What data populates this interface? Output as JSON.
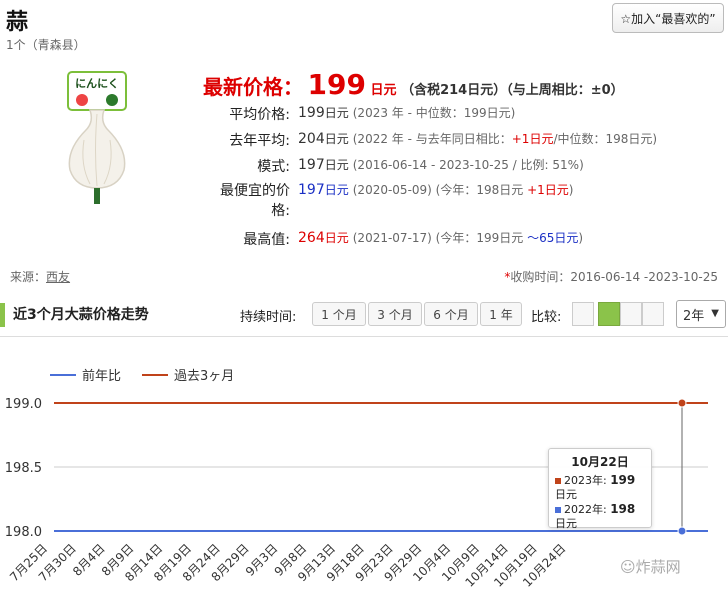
{
  "header": {
    "title": "蒜",
    "subtitle": "1个（青森县）",
    "fav_button": "☆加入“最喜欢的”"
  },
  "product_image": {
    "label_text": "にんにく"
  },
  "latest": {
    "label": "最新价格：",
    "value": "199",
    "unit": "日元",
    "note": "（含税214日元）（与上周相比：±0）"
  },
  "stats": [
    {
      "key": "平均价格:",
      "value": "199",
      "unit": "日元",
      "value_color": "normal",
      "note": "(2023 年 - 中位数：199日元)"
    },
    {
      "key": "去年平均:",
      "value": "204",
      "unit": "日元",
      "value_color": "normal",
      "note_pre": "(2022 年 - 与去年同日相比：",
      "note_hl": "+1日元",
      "note_post": "/中位数：198日元)"
    },
    {
      "key": "模式:",
      "value": "197",
      "unit": "日元",
      "value_color": "normal",
      "note": "(2016-06-14 - 2023-10-25 / 比例: 51%)"
    },
    {
      "key_line1": "最便宜的价",
      "key_line2": "格:",
      "value": "197",
      "unit": "日元",
      "value_color": "blue",
      "note_pre": "(2020-05-09) (今年：198日元 ",
      "note_hl": "+1日元",
      "note_post": ")"
    },
    {
      "key": "最高值:",
      "value": "264",
      "unit": "日元",
      "value_color": "red",
      "note_pre": "(2021-07-17) (今年：199日元 ",
      "note_hl": "～65日元",
      "note_post": ")"
    }
  ],
  "source": {
    "label": "来源：",
    "link": "西友"
  },
  "period": {
    "star": "*",
    "text": "收购时间：2016-06-14 -2023-10-25"
  },
  "trend": {
    "title": "近3个月大蒜价格走势",
    "duration_label": "持续时间:",
    "duration_buttons": [
      "1 个月",
      "3 个月",
      "6 个月",
      "1 年"
    ],
    "compare_label": "比较:",
    "year_select": "2年"
  },
  "colors": {
    "blue_series": "#4a6fd8",
    "red_series": "#c0431a",
    "accent_green": "#8bc34a"
  },
  "chart_data": {
    "type": "line",
    "x": [
      "7月25日",
      "7月30日",
      "8月4日",
      "8月9日",
      "8月14日",
      "8月19日",
      "8月24日",
      "8月29日",
      "9月3日",
      "9月8日",
      "9月13日",
      "9月18日",
      "9月23日",
      "9月29日",
      "10月4日",
      "10月9日",
      "10月14日",
      "10月19日",
      "10月24日"
    ],
    "series": [
      {
        "name": "前年比",
        "color": "#4a6fd8",
        "values": [
          198,
          198,
          198,
          198,
          198,
          198,
          198,
          198,
          198,
          198,
          198,
          198,
          198,
          198,
          198,
          198,
          198,
          198,
          198
        ]
      },
      {
        "name": "過去3ヶ月",
        "color": "#c0431a",
        "values": [
          199,
          199,
          199,
          199,
          199,
          199,
          199,
          199,
          199,
          199,
          199,
          199,
          199,
          199,
          199,
          199,
          199,
          199,
          199
        ]
      }
    ],
    "yticks": [
      "199.0",
      "198.5",
      "198.0"
    ],
    "ylim": [
      198.0,
      199.0
    ],
    "legend": "top-left",
    "tooltip": {
      "date": "10月22日",
      "row1_label": "2023年:",
      "row1_value": "199",
      "row2_label": "2022年:",
      "row2_value": "198",
      "unit": "日元"
    }
  },
  "watermark": "☺炸蒜网"
}
